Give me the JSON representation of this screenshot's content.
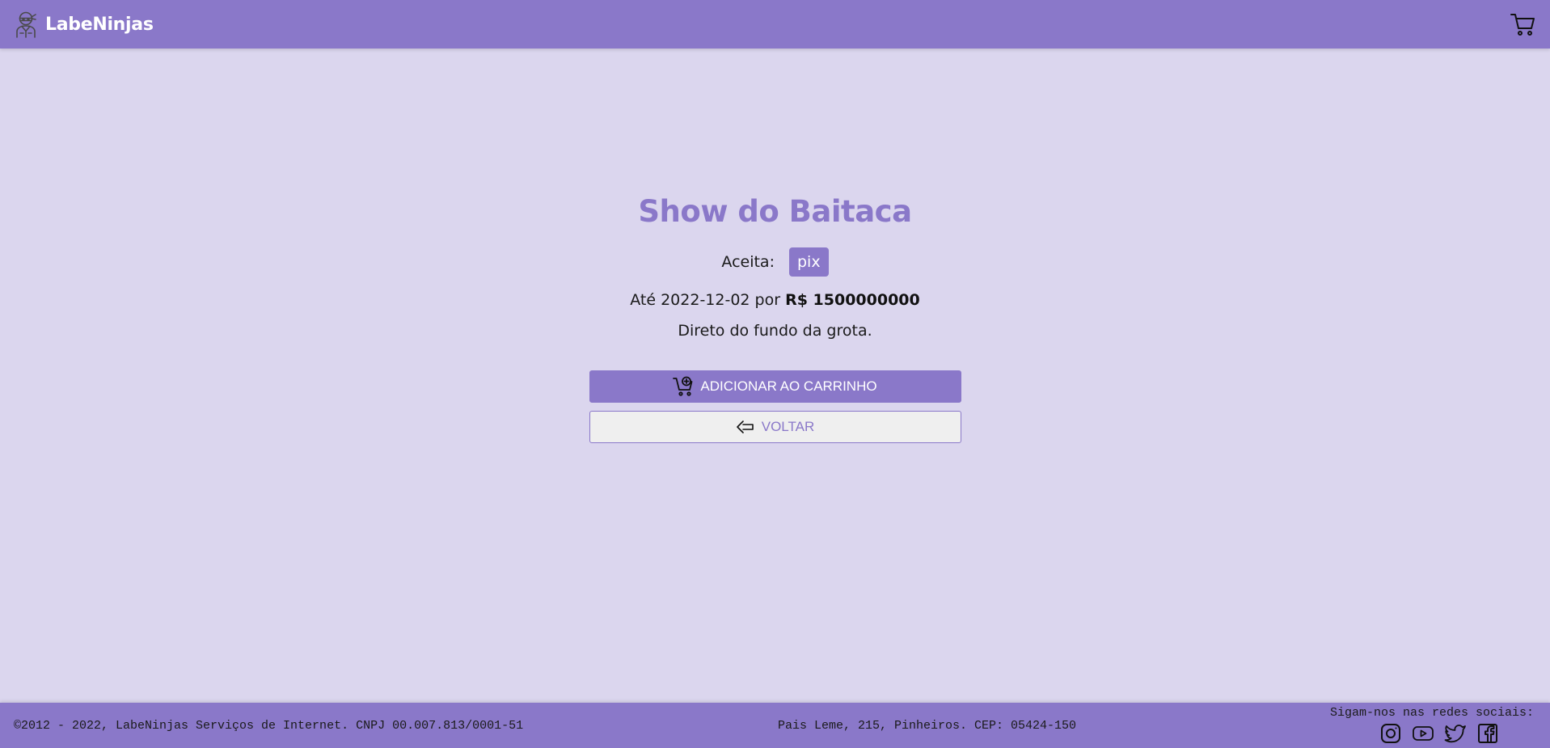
{
  "header": {
    "brand_name": "LabeNinjas",
    "logo_icon": "ninja-icon",
    "cart_icon": "cart-icon"
  },
  "service": {
    "title": "Show do Baitaca",
    "accepts_label": "Aceita:",
    "payment_methods": [
      "pix"
    ],
    "deadline_prefix": "Até 2022-12-02 por",
    "price": "R$ 1500000000",
    "description": "Direto do fundo da grota."
  },
  "actions": {
    "add_to_cart_label": "ADICIONAR AO CARRINHO",
    "add_to_cart_icon": "cart-add-icon",
    "back_label": "VOLTAR",
    "back_icon": "arrow-left-icon"
  },
  "footer": {
    "copyright": "©2012 - 2022, LabeNinjas Serviços de Internet. CNPJ 00.007.813/0001-51",
    "address": "Pais Leme, 215, Pinheiros. CEP: 05424-150",
    "social_label": "Sigam-nos nas redes sociais:",
    "social_icons": [
      "instagram-icon",
      "youtube-icon",
      "twitter-icon",
      "facebook-icon"
    ]
  },
  "colors": {
    "primary": "#8a78c9",
    "background": "#dbd6ee",
    "button_secondary_bg": "#efefef",
    "text": "#1a1a1a"
  }
}
